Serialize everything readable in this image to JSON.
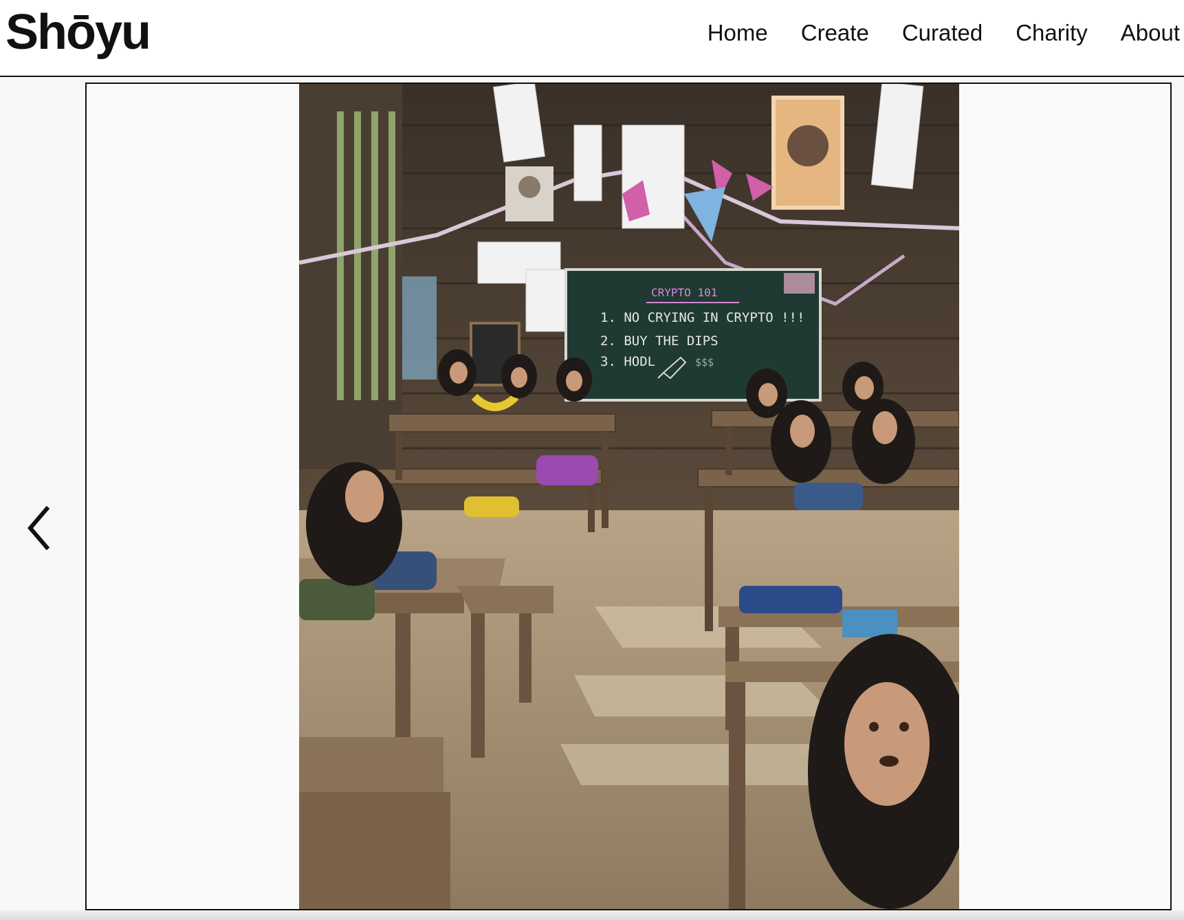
{
  "header": {
    "logo": "Shōyu",
    "nav": [
      "Home",
      "Create",
      "Curated",
      "Charity",
      "About"
    ]
  },
  "viewer": {
    "prev_icon": "chevron-left-icon",
    "artwork": {
      "subject": "chimpanzee-classroom",
      "chalkboard": {
        "title": "CRYPTO 101",
        "lines": [
          "1. NO CRYING IN CRYPTO !!!",
          "2. BUY THE DIPS",
          "3. HODL",
          "$$$"
        ]
      }
    }
  },
  "colors": {
    "text": "#111111",
    "header_bg": "#ffffff",
    "page_bg": "#f7f7f7",
    "chalkboard": "#1f3a33"
  }
}
